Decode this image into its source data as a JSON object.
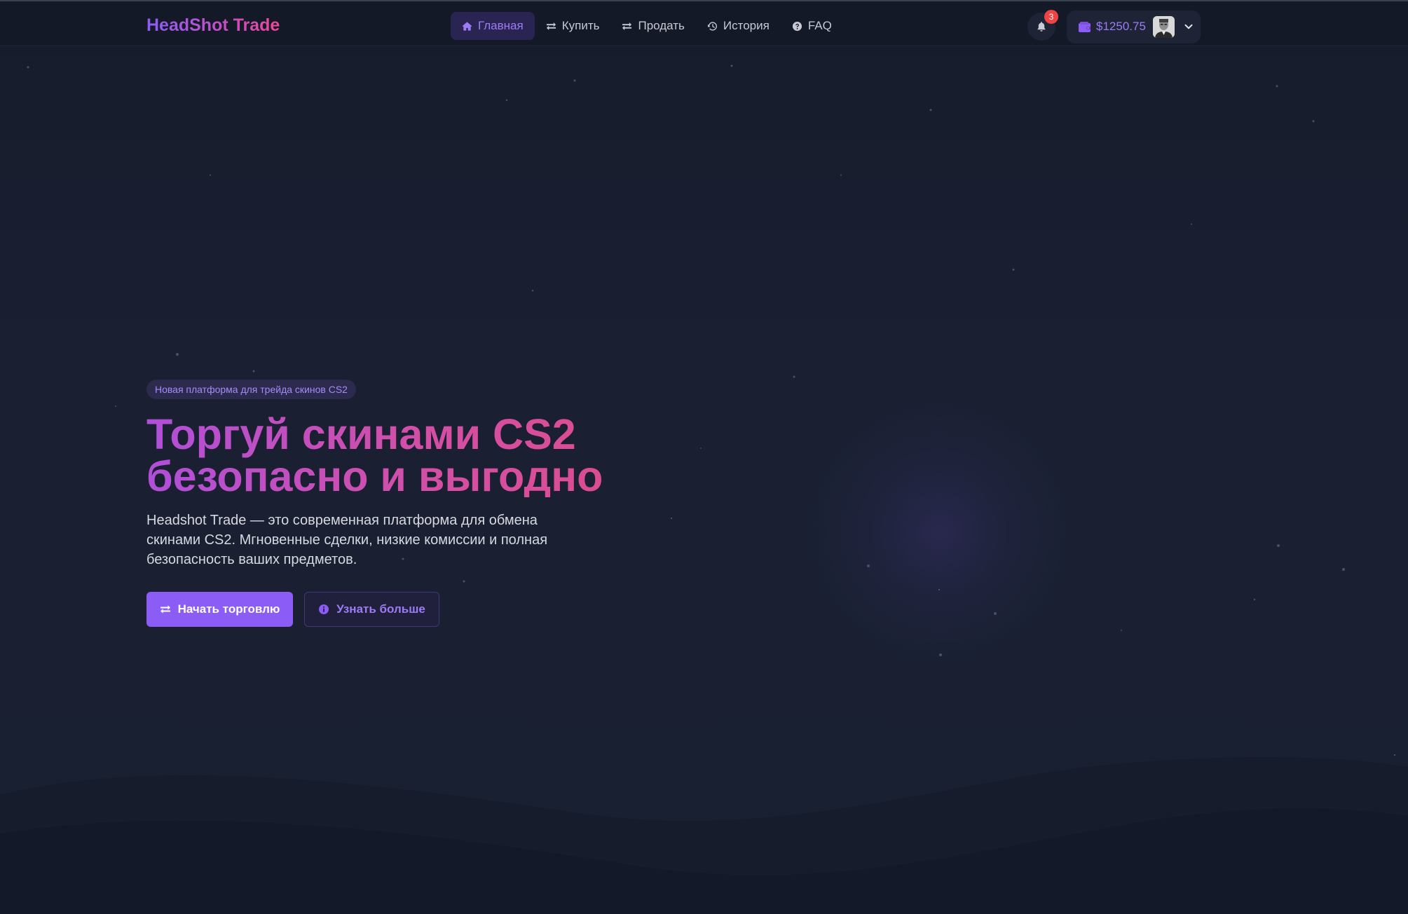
{
  "header": {
    "logo": "HeadShot Trade",
    "nav": [
      {
        "label": "Главная",
        "icon": "home-icon",
        "active": true
      },
      {
        "label": "Купить",
        "icon": "exchange-icon",
        "active": false
      },
      {
        "label": "Продать",
        "icon": "exchange-icon",
        "active": false
      },
      {
        "label": "История",
        "icon": "history-icon",
        "active": false
      },
      {
        "label": "FAQ",
        "icon": "question-circle-icon",
        "active": false
      }
    ],
    "notifications": {
      "count": "3",
      "icon": "bell-icon"
    },
    "wallet": {
      "balance": "$1250.75",
      "icon": "wallet-icon",
      "dropdown_icon": "chevron-down-icon"
    }
  },
  "hero": {
    "tag": "Новая платформа для трейда скинов CS2",
    "title_line1": "Торгуй скинами CS2",
    "title_line2": "безопасно и выгодно",
    "subtitle": "Headshot Trade — это современная платформа для обмена скинами CS2. Мгновенные сделки, низкие комиссии и полная безопасность ваших предметов.",
    "primary_button": {
      "label": "Начать торговлю",
      "icon": "exchange-icon"
    },
    "secondary_button": {
      "label": "Узнать больше",
      "icon": "info-circle-icon"
    }
  },
  "colors": {
    "background": "#181d2e",
    "header": "#141928",
    "accent": "#8b5cf6",
    "accent_text": "#9c7cf5",
    "gradient_start": "#b04fd9",
    "gradient_end": "#db4d92",
    "badge": "#ef4444"
  }
}
